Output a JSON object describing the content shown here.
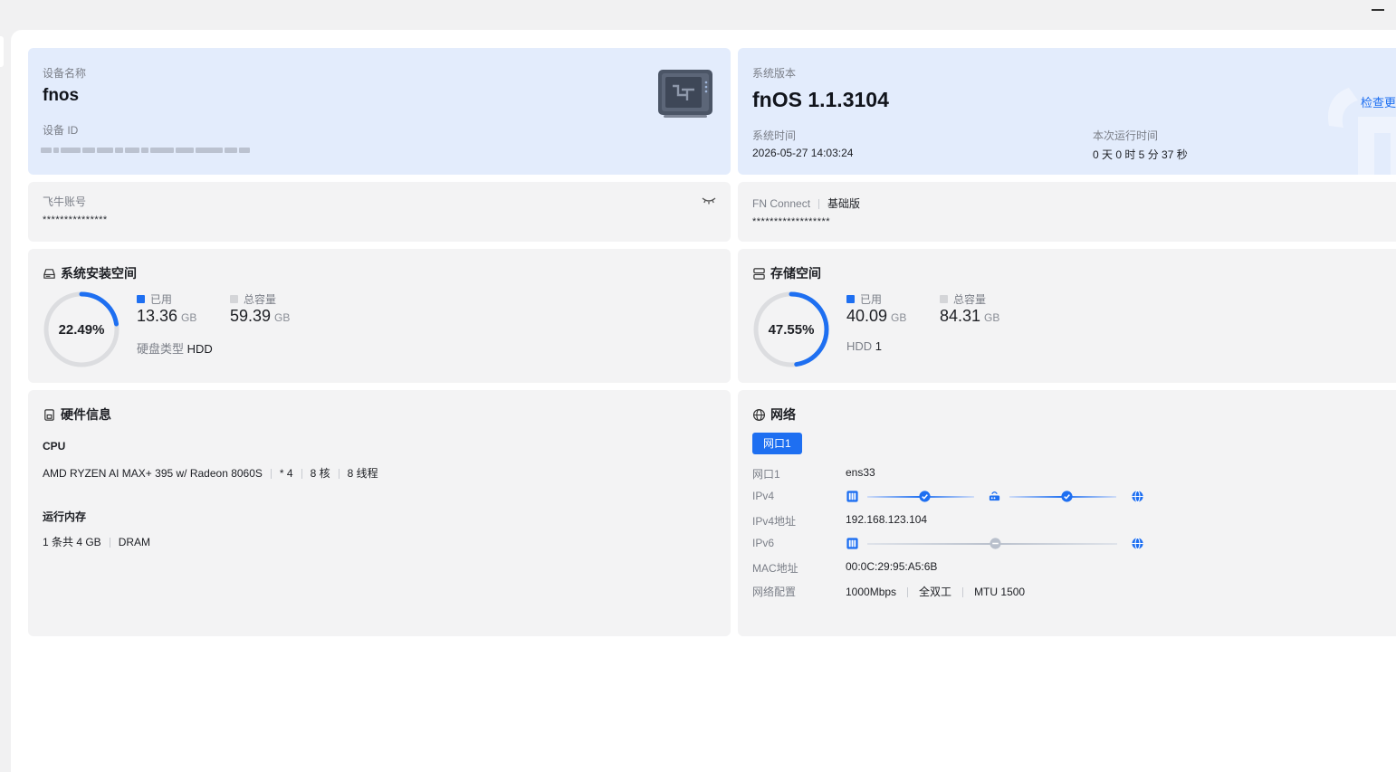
{
  "device": {
    "name_label": "设备名称",
    "name": "fnos",
    "id_label": "设备 ID"
  },
  "system": {
    "version_label": "系统版本",
    "version": "fnOS  1.1.3104",
    "check_update": "检查更",
    "time_label": "系统时间",
    "time": "2026-05-27 14:03:24",
    "uptime_label": "本次运行时间",
    "uptime": "0 天 0 时 5 分 37 秒"
  },
  "account": {
    "label": "飞牛账号",
    "value": "***************"
  },
  "connect": {
    "label": "FN Connect",
    "plan": "基础版",
    "value": "******************"
  },
  "install_space": {
    "title": "系统安装空间",
    "percent": 22.49,
    "percent_text": "22.49%",
    "used_label": "已用",
    "used": "13.36",
    "used_unit": "GB",
    "total_label": "总容量",
    "total": "59.39",
    "total_unit": "GB",
    "disk_type_label": "硬盘类型",
    "disk_type": "HDD"
  },
  "storage": {
    "title": "存储空间",
    "percent": 47.55,
    "percent_text": "47.55%",
    "used_label": "已用",
    "used": "40.09",
    "used_unit": "GB",
    "total_label": "总容量",
    "total": "84.31",
    "total_unit": "GB",
    "hdd_label": "HDD",
    "hdd_count": "1"
  },
  "hardware": {
    "title": "硬件信息",
    "cpu_label": "CPU",
    "cpu_model": "AMD RYZEN AI MAX+ 395 w/ Radeon 8060S",
    "cpu_count": "* 4",
    "cpu_cores": "8 核",
    "cpu_threads": "8 线程",
    "mem_label": "运行内存",
    "mem_summary": "1 条共 4 GB",
    "mem_type": "DRAM"
  },
  "network": {
    "title": "网络",
    "tab": "网口1",
    "rows": {
      "port_label": "网口1",
      "port": "ens33",
      "ipv4_label": "IPv4",
      "ipv4_addr_label": "IPv4地址",
      "ipv4_addr": "192.168.123.104",
      "ipv6_label": "IPv6",
      "mac_label": "MAC地址",
      "mac": "00:0C:29:95:A5:6B",
      "config_label": "网络配置",
      "speed": "1000Mbps",
      "duplex": "全双工",
      "mtu": "MTU 1500"
    }
  },
  "colors": {
    "accent": "#1e6ff1",
    "track": "#dcdde0",
    "card": "#f3f3f4",
    "card_highlight": "#e3ecfc"
  }
}
